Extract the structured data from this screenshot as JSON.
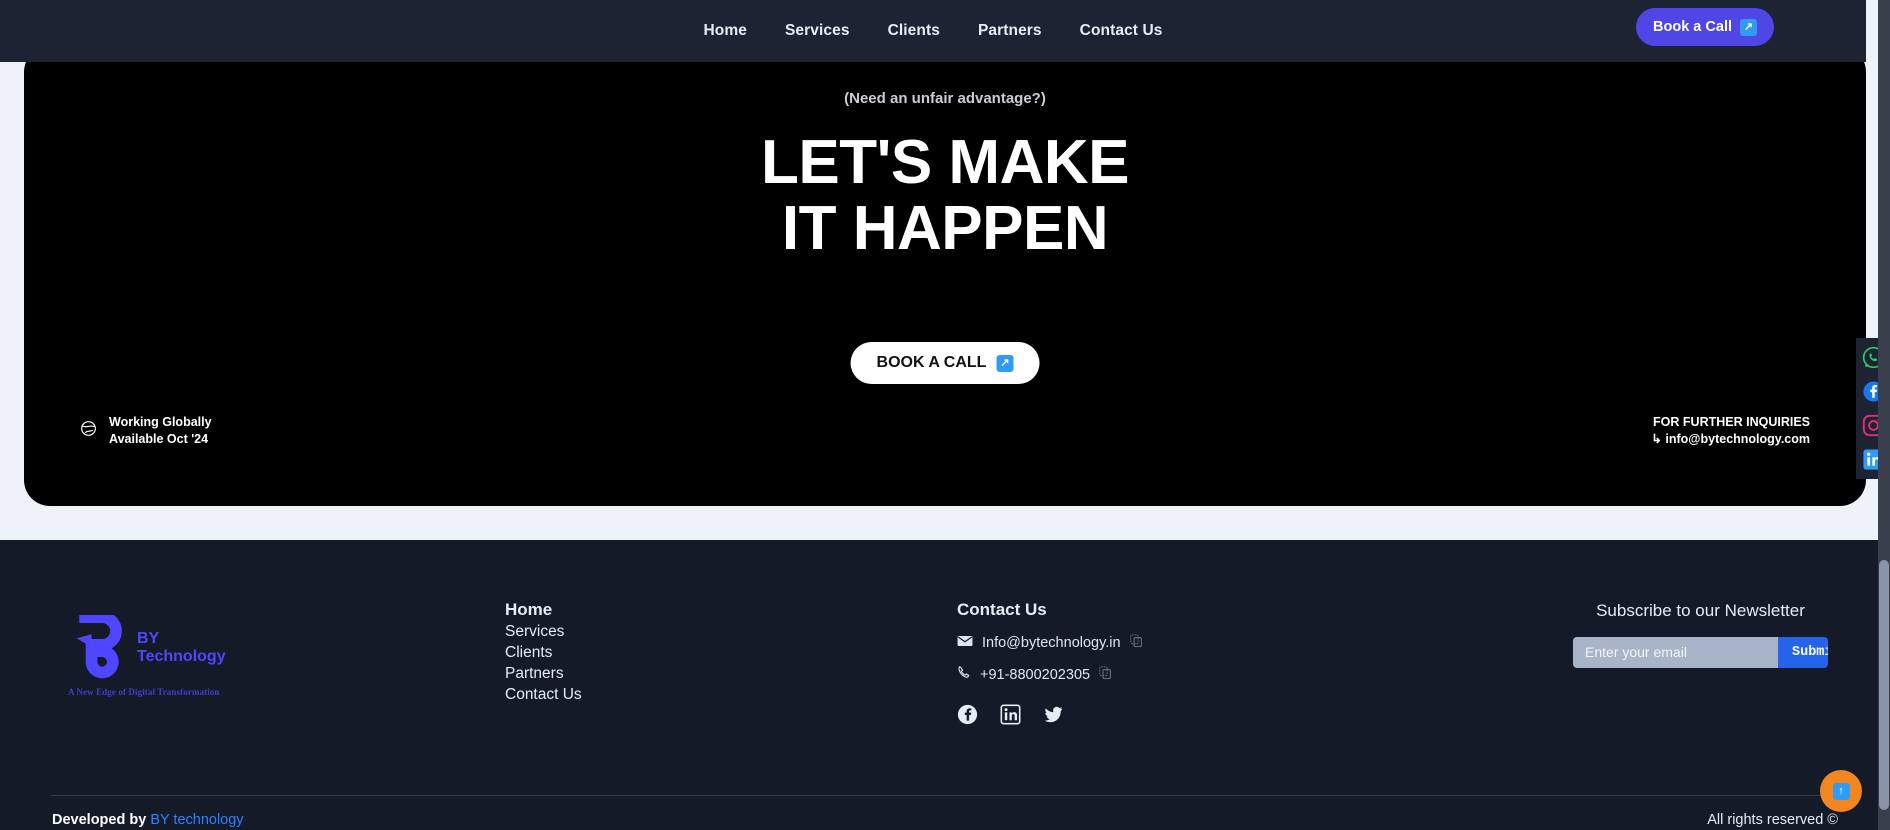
{
  "brand": {
    "line1": "BY",
    "line2": "Technology",
    "tagline": "A New Edge of Digital Transformation",
    "color": "#4f46ff"
  },
  "header": {
    "nav": [
      {
        "label": "Home"
      },
      {
        "label": "Services"
      },
      {
        "label": "Clients"
      },
      {
        "label": "Partners"
      },
      {
        "label": "Contact Us"
      }
    ],
    "cta": {
      "label": "Book a Call",
      "icon": "arrow-up-right-icon",
      "bg": "#4f46e5",
      "icon_bg": "#2f9bf5"
    }
  },
  "hero": {
    "kicker": "(Need an unfair advantage?)",
    "title_line1": "LET'S MAKE",
    "title_line2": "IT HAPPEN",
    "cta": {
      "label": "BOOK A CALL",
      "icon": "arrow-up-right-icon"
    },
    "location": {
      "icon": "globe-icon",
      "line1": "Working Globally",
      "line2": "Available Oct '24"
    },
    "inquiries": {
      "heading": "FOR FURTHER INQUIRIES",
      "arrow": "↳",
      "email": "info@bytechnology.com"
    },
    "bg": "#000000"
  },
  "footer": {
    "nav": [
      {
        "label": "Home"
      },
      {
        "label": "Services"
      },
      {
        "label": "Clients"
      },
      {
        "label": "Partners"
      },
      {
        "label": "Contact Us"
      }
    ],
    "contact": {
      "heading": "Contact Us",
      "email": "Info@bytechnology.in",
      "phone": "+91-8800202305",
      "email_icon": "mail-icon",
      "phone_icon": "phone-icon",
      "copy_icon": "copy-icon",
      "socials": [
        {
          "name": "facebook-icon"
        },
        {
          "name": "linkedin-icon"
        },
        {
          "name": "twitter-icon"
        }
      ]
    },
    "newsletter": {
      "heading": "Subscribe to our Newsletter",
      "placeholder": "Enter your email",
      "value": "",
      "submit_label": "Submit",
      "submit_bg": "#2563eb"
    },
    "bottom": {
      "developed_prefix": "Developed by",
      "developed_link": "BY technology",
      "rights": "All rights reserved ©",
      "link_color": "#2f80ff"
    }
  },
  "side_socials": [
    {
      "name": "whatsapp-icon",
      "color": "#25d366"
    },
    {
      "name": "facebook-icon",
      "color": "#1877f2"
    },
    {
      "name": "instagram-icon",
      "color": "#e1306c"
    },
    {
      "name": "linkedin-icon",
      "color": "#0a66c2"
    }
  ],
  "scroll_top": {
    "icon": "arrow-up-icon",
    "bg": "#f3861f",
    "icon_bg": "#2f9bf5"
  }
}
